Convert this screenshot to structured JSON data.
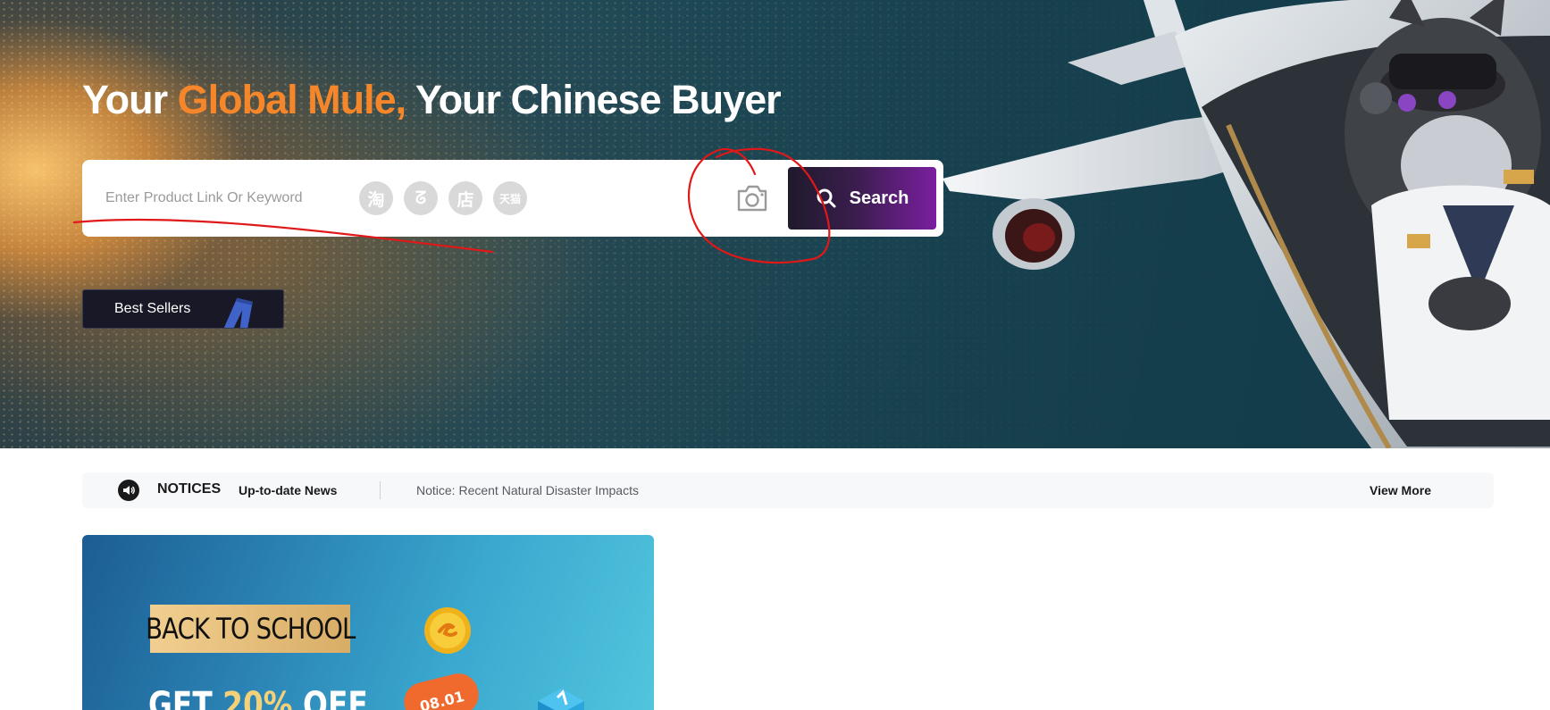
{
  "hero": {
    "title_part1": "Your ",
    "title_accent": "Global Mule,",
    "title_part2": " Your Chinese Buyer",
    "accent_color": "#f5862a"
  },
  "search": {
    "placeholder": "Enter Product Link Or Keyword",
    "platforms": [
      {
        "name": "taobao-icon",
        "glyph": "淘"
      },
      {
        "name": "1688-icon",
        "glyph": "ᘔ"
      },
      {
        "name": "store-icon",
        "glyph": "店"
      },
      {
        "name": "tmall-icon",
        "glyph": "天猫"
      }
    ],
    "button_label": "Search",
    "button_gradient": [
      "#1f1a2b",
      "#7a1fa0"
    ]
  },
  "best_sellers": {
    "label": "Best Sellers"
  },
  "notice": {
    "title": "NOTICES",
    "subtitle": "Up-to-date News",
    "text": "Notice: Recent Natural Disaster Impacts",
    "more_label": "View More"
  },
  "promo": {
    "tag": "BACK TO SCHOOL",
    "offer_prefix": "GET ",
    "offer_highlight": "20%",
    "offer_suffix": " OFF",
    "date": "08.01"
  },
  "annotation_color": "#e01818"
}
